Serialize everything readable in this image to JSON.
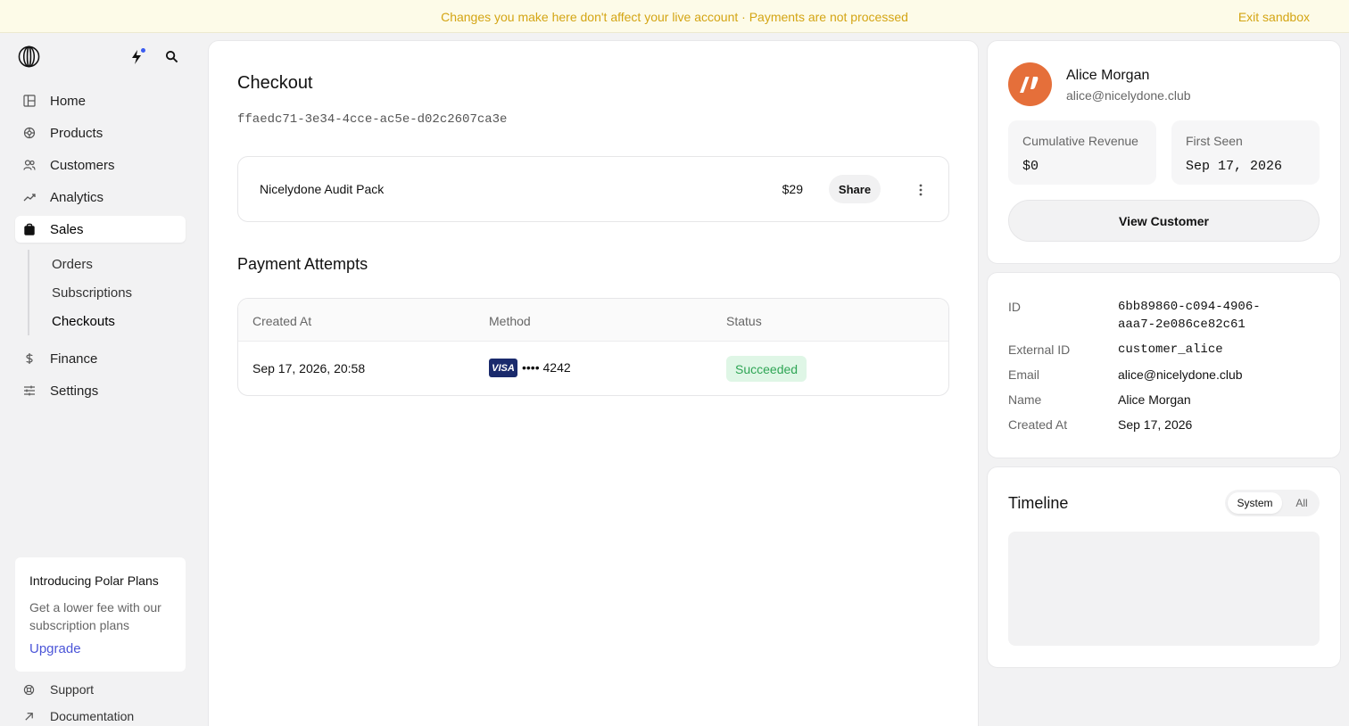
{
  "banner": {
    "message": "Changes you make here don't affect your live account · Payments are not processed",
    "exit_label": "Exit sandbox",
    "color": "#d4a514"
  },
  "sidebar": {
    "items": [
      {
        "label": "Home",
        "icon": "home-icon"
      },
      {
        "label": "Products",
        "icon": "products-icon"
      },
      {
        "label": "Customers",
        "icon": "customers-icon"
      },
      {
        "label": "Analytics",
        "icon": "analytics-icon"
      },
      {
        "label": "Sales",
        "icon": "sales-icon"
      },
      {
        "label": "Finance",
        "icon": "finance-icon"
      },
      {
        "label": "Settings",
        "icon": "settings-icon"
      }
    ],
    "sales_sub": [
      "Orders",
      "Subscriptions",
      "Checkouts"
    ],
    "active_item": "Sales",
    "active_sub": "Checkouts",
    "promo": {
      "title": "Introducing Polar Plans",
      "text": "Get a lower fee with our subscription plans",
      "link": "Upgrade"
    },
    "footer": [
      {
        "label": "Support",
        "icon": "support-icon"
      },
      {
        "label": "Documentation",
        "icon": "external-link-icon"
      }
    ]
  },
  "checkout": {
    "title": "Checkout",
    "id": "ffaedc71-3e34-4cce-ac5e-d02c2607ca3e",
    "product": {
      "name": "Nicelydone Audit Pack",
      "price": "$29",
      "share_label": "Share"
    },
    "attempts_title": "Payment Attempts",
    "columns": [
      "Created At",
      "Method",
      "Status"
    ],
    "rows": [
      {
        "created_at": "Sep 17, 2026, 20:58",
        "card_brand": "VISA",
        "card": "•••• 4242",
        "status": "Succeeded"
      }
    ]
  },
  "customer": {
    "name": "Alice Morgan",
    "email": "alice@nicelydone.club",
    "cumulative_revenue_label": "Cumulative Revenue",
    "cumulative_revenue": "$0",
    "first_seen_label": "First Seen",
    "first_seen": "Sep 17, 2026",
    "view_label": "View Customer",
    "avatar_color": "#e56f3a"
  },
  "details": [
    {
      "label": "ID",
      "value": "6bb89860-c094-4906-aaa7-2e086ce82c61",
      "mono": true
    },
    {
      "label": "External ID",
      "value": "customer_alice",
      "mono": true
    },
    {
      "label": "Email",
      "value": "alice@nicelydone.club",
      "mono": false
    },
    {
      "label": "Name",
      "value": "Alice Morgan",
      "mono": false
    },
    {
      "label": "Created At",
      "value": "Sep 17, 2026",
      "mono": false
    }
  ],
  "timeline": {
    "title": "Timeline",
    "options": [
      "System",
      "All"
    ],
    "selected": "System"
  }
}
